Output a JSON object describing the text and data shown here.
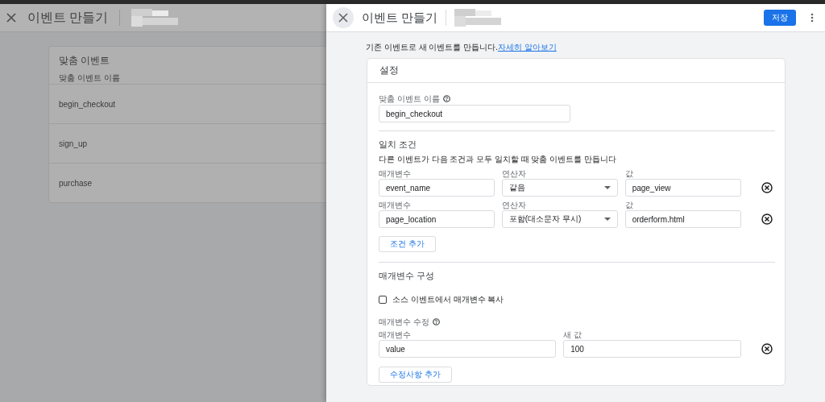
{
  "background": {
    "title": "이벤트 만들기",
    "card_title": "맞춤 이벤트",
    "column_1": "맞춤 이벤트 이름",
    "rows": [
      "begin_checkout",
      "sign_up",
      "purchase"
    ]
  },
  "panel": {
    "title": "이벤트 만들기",
    "save": "저장",
    "intro": "기존 이벤트로 새 이벤트를 만듭니다.",
    "intro_link": "자세히 알아보기",
    "settings": {
      "title": "설정",
      "name_label": "맞춤 이벤트 이름",
      "name_value": "begin_checkout",
      "match_title": "일치 조건",
      "match_desc": "다른 이벤트가 다음 조건과 모두 일치할 때 맞춤 이벤트를 만듭니다",
      "conditions": [
        {
          "parameter_label": "매개변수",
          "parameter": "event_name",
          "operator_label": "연산자",
          "operator": "같음",
          "value_label": "값",
          "value": "page_view"
        },
        {
          "parameter_label": "매개변수",
          "parameter": "page_location",
          "operator_label": "연산자",
          "operator": "포함(대소문자 무시)",
          "value_label": "값",
          "value": "orderform.html"
        }
      ],
      "add_condition": "조건 추가",
      "param_title": "매개변수 구성",
      "copy_params": {
        "label": "소스 이벤트에서 매개변수 복사",
        "checked": false
      },
      "modify_label": "매개변수 수정",
      "modifications": [
        {
          "parameter_label": "매개변수",
          "parameter": "value",
          "new_value_label": "새 값",
          "new_value": "100"
        }
      ],
      "add_modification": "수정사항 추가"
    }
  }
}
